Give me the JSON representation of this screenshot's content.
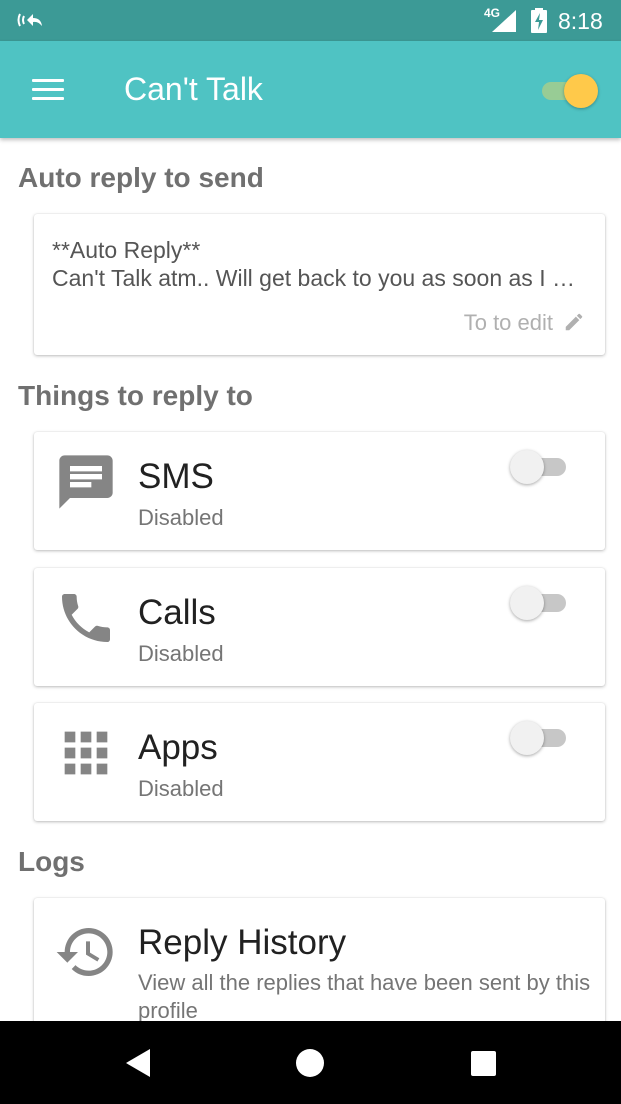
{
  "status_bar": {
    "network": "4G",
    "time": "8:18",
    "icons": [
      "call-forwarding-icon",
      "signal-icon",
      "battery-charging-icon"
    ]
  },
  "app_bar": {
    "title": "Can't Talk",
    "menu_icon": "menu-icon",
    "master_enabled": true,
    "accent": "#4fc3c3"
  },
  "auto_reply": {
    "section_title": "Auto reply to send",
    "line1": "**Auto Reply**",
    "line2": "Can't Talk atm.. Will get back to you as soon as I …",
    "edit_hint": "To to edit",
    "edit_icon": "pencil-icon"
  },
  "things": {
    "section_title": "Things to reply to",
    "items": [
      {
        "title": "SMS",
        "status": "Disabled",
        "icon": "message-icon",
        "enabled": false
      },
      {
        "title": "Calls",
        "status": "Disabled",
        "icon": "phone-icon",
        "enabled": false
      },
      {
        "title": "Apps",
        "status": "Disabled",
        "icon": "apps-grid-icon",
        "enabled": false
      }
    ]
  },
  "logs": {
    "section_title": "Logs",
    "history": {
      "title": "Reply History",
      "subtitle": "View all the replies that have been sent by this profile",
      "icon": "history-icon"
    }
  },
  "nav_bar": {
    "buttons": [
      "back-icon",
      "home-icon",
      "recents-icon"
    ]
  }
}
